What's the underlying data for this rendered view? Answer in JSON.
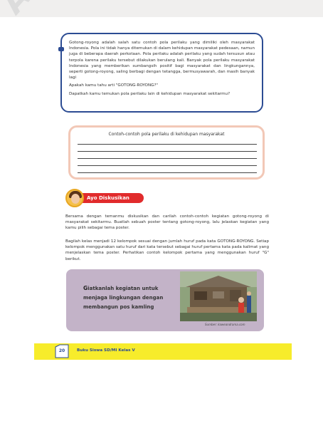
{
  "watermark": {
    "text": "Abou"
  },
  "intro": {
    "paragraph": "Gotong-royong adalah salah satu contoh pola perilaku yang dimiliki oleh masyarakat Indonesia. Pola ini tidak hanya ditemukan di dalam kehidupan masyarakat pedesaan, namun juga di beberapa daerah perkotaan. Pola perilaku adalah perilaku yang sudah tersusun atau terpola karena perilaku tersebut dilakukan berulang kali. Banyak pola perilaku masyarakat Indonesia yang memberikan sumbangsih positif bagi masyarakat dan lingkungannya, seperti gotong-royong, saling berbagi dengan tetangga, bermusyawarah, dan masih banyak lagi",
    "question1": "Apakah kamu tahu arti \"GOTONG-ROYONG?\"",
    "question2": "Dapatkah kamu temukan pola perilaku lain di kehidupan masyarakat sekitarmu?"
  },
  "examples": {
    "title": "Contoh-contoh pola perilaku di kehidupan masyarakat",
    "blank_lines": 5
  },
  "discussion": {
    "badge_label": "Ayo Diskusikan",
    "paragraph1": "Bersama dengan temanmu diskusikan dan carilah contoh-contoh kegiatan gotong-royong di masyarakat sekitarmu. Buatlah sebuah poster tentang gotong-royong, lalu jelaskan kegiatan yang kamu pilih sebagai tema poster.",
    "paragraph2": "Bagilah kelas menjadi 12 kelompok sesuai dengan jumlah huruf pada kata GOTONG-ROYONG. Setiap kelompok menggunakan satu huruf dari kata tersebut sebagai huruf pertama kata pada kalimat yang menjelaskan tema poster. Perhatikan contoh kelompok pertama yang menggunakan huruf \"G\" berikut."
  },
  "poster": {
    "first_letter": "G",
    "text_rest": "iatkanlah kegiatan untuk menjaga lingkungan dengan membangun pos kamling",
    "source": "Sumber: kaweandrama.com"
  },
  "footer": {
    "page_number": "20",
    "book_title": "Buku Siswa SD/MI Kelas V"
  },
  "colors": {
    "border_blue": "#2c4c93",
    "border_peach": "#f2c8b7",
    "badge_red": "#e12b2c",
    "poster_purple": "#c3b3c8",
    "footer_yellow": "#f7ec2b"
  }
}
